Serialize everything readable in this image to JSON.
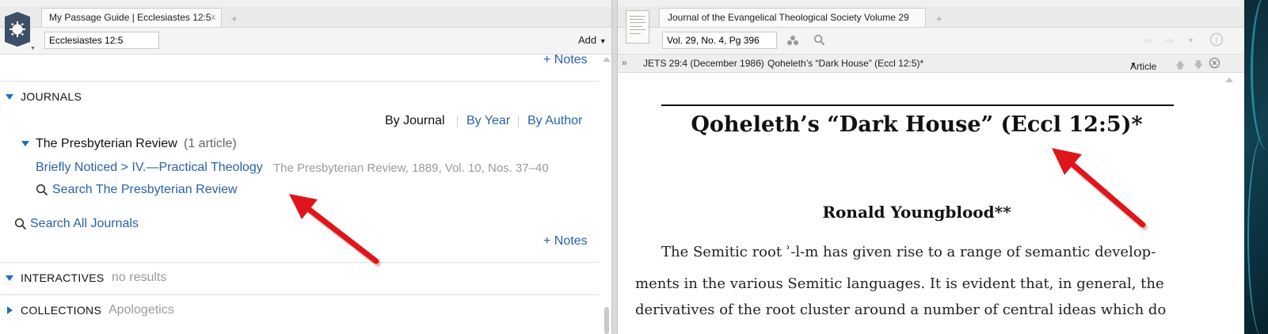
{
  "left": {
    "tab_title": "My Passage Guide | Ecclesiastes 12:5",
    "tab_close": "x",
    "new_tab": "+",
    "reference_input": "Ecclesiastes 12:5",
    "add_button": "Add",
    "notes_top": "+ Notes",
    "journals": {
      "header": "JOURNALS",
      "view_tabs": {
        "by_journal": "By Journal",
        "by_year": "By Year",
        "by_author": "By Author"
      },
      "group_title": "The Presbyterian Review",
      "group_count": "(1 article)",
      "article_link": "Briefly Noticed > IV.—Practical Theology",
      "article_source": "The Presbyterian Review, 1889, Vol. 10, Nos. 37–40",
      "search_review": "Search The Presbyterian Review",
      "search_all": "Search All Journals",
      "notes": "+ Notes"
    },
    "interactives": {
      "header": "INTERACTIVES",
      "status": "no results"
    },
    "collections": {
      "header": "COLLECTIONS",
      "status": "Apologetics"
    }
  },
  "right": {
    "tab_title": "Journal of the Evangelical Theological Society Volume 29",
    "new_tab": "+",
    "reference_input": "Vol. 29, No. 4, Pg 396",
    "breadcrumb": {
      "expand": "»",
      "issue": "JETS 29:4 (December 1986)",
      "separator": "›",
      "article": "Qoheleth’s “Dark House” (Eccl 12:5)*"
    },
    "view_menu": "Article",
    "article": {
      "title": "Qoheleth’s “Dark House” (Eccl 12:5)*",
      "author": "Ronald Youngblood**",
      "lines": [
        "The Semitic root ʾ-l-m has given rise to a range of semantic develop-",
        "ments in the various Semitic languages. It is evident that, in general, the",
        "derivatives of the root cluster around a number of central ideas which do"
      ]
    }
  },
  "colors": {
    "link_blue": "#2a62a8",
    "disclosure_blue": "#1e6fc1",
    "annotation_red": "#e0141b"
  }
}
